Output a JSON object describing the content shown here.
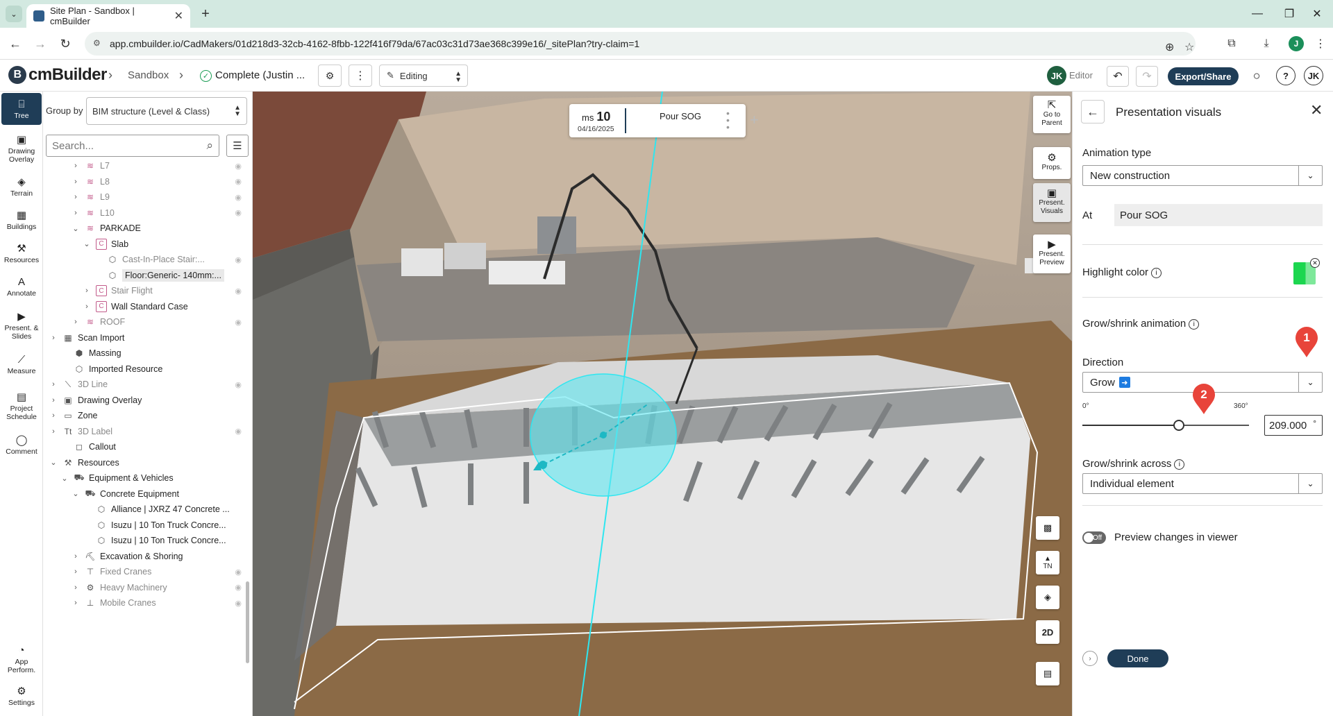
{
  "browser": {
    "tab_title": "Site Plan - Sandbox | cmBuilder",
    "tab_close": "✕",
    "new_tab": "+",
    "url": "app.cmbuilder.io/CadMakers/01d218d3-32cb-4162-8fbb-122f416f79da/67ac03c31d73ae368c399e16/_sitePlan?try-claim=1",
    "profile_initial": "J"
  },
  "header": {
    "logo_text": "cmBuilder",
    "crumb_project": "Sandbox",
    "crumb_status": "Complete (Justin ...",
    "mode_label": "Editing",
    "user_initials": "JK",
    "user_role": "Editor",
    "export_label": "Export/Share",
    "help_label": "?",
    "account_initials": "JK"
  },
  "rail": {
    "items": [
      {
        "label": "Tree"
      },
      {
        "label": "Drawing Overlay"
      },
      {
        "label": "Terrain"
      },
      {
        "label": "Buildings"
      },
      {
        "label": "Resources"
      },
      {
        "label": "Annotate"
      },
      {
        "label": "Present. & Slides"
      },
      {
        "label": "Measure"
      },
      {
        "label": "Project Schedule"
      },
      {
        "label": "Comment"
      },
      {
        "label": "App Perform."
      },
      {
        "label": "Settings"
      }
    ]
  },
  "tree": {
    "groupby_label": "Group by",
    "groupby_value": "BIM structure (Level & Class)",
    "search_placeholder": "Search...",
    "rows": [
      {
        "label": "L7",
        "indent": 2,
        "icon": "layer",
        "chev": "›",
        "dim": true
      },
      {
        "label": "L8",
        "indent": 2,
        "icon": "layer",
        "chev": "›",
        "dim": true
      },
      {
        "label": "L9",
        "indent": 2,
        "icon": "layer",
        "chev": "›",
        "dim": true
      },
      {
        "label": "L10",
        "indent": 2,
        "icon": "layer",
        "chev": "›",
        "dim": true
      },
      {
        "label": "PARKADE",
        "indent": 2,
        "icon": "layer",
        "chev": "⌄",
        "dim": false
      },
      {
        "label": "Slab",
        "indent": 3,
        "icon": "cls",
        "chev": "⌄",
        "dim": false
      },
      {
        "label": "Cast-In-Place Stair:...",
        "indent": 4,
        "icon": "cube",
        "chev": "",
        "dim": true
      },
      {
        "label": "Floor:Generic- 140mm:...",
        "indent": 4,
        "icon": "cube",
        "chev": "",
        "dim": false,
        "selected": true
      },
      {
        "label": "Stair Flight",
        "indent": 3,
        "icon": "cls",
        "chev": "›",
        "dim": true
      },
      {
        "label": "Wall Standard Case",
        "indent": 3,
        "icon": "cls",
        "chev": "›",
        "dim": false
      },
      {
        "label": "ROOF",
        "indent": 2,
        "icon": "layer",
        "chev": "›",
        "dim": true
      },
      {
        "label": "Scan Import",
        "indent": 0,
        "icon": "scan",
        "chev": "›",
        "dim": false
      },
      {
        "label": "Massing",
        "indent": 1,
        "icon": "massing",
        "chev": "",
        "dim": false
      },
      {
        "label": "Imported Resource",
        "indent": 1,
        "icon": "imported",
        "chev": "",
        "dim": false
      },
      {
        "label": "3D Line",
        "indent": 0,
        "icon": "line",
        "chev": "›",
        "dim": true
      },
      {
        "label": "Drawing Overlay",
        "indent": 0,
        "icon": "overlay",
        "chev": "›",
        "dim": false
      },
      {
        "label": "Zone",
        "indent": 0,
        "icon": "zone",
        "chev": "›",
        "dim": false
      },
      {
        "label": "3D Label",
        "indent": 0,
        "icon": "label3d",
        "chev": "›",
        "dim": true
      },
      {
        "label": "Callout",
        "indent": 1,
        "icon": "callout",
        "chev": "",
        "dim": false
      },
      {
        "label": "Resources",
        "indent": 0,
        "icon": "resources",
        "chev": "⌄",
        "dim": false
      },
      {
        "label": "Equipment & Vehicles",
        "indent": 1,
        "icon": "vehicle",
        "chev": "⌄",
        "dim": false
      },
      {
        "label": "Concrete Equipment",
        "indent": 2,
        "icon": "truck",
        "chev": "⌄",
        "dim": false
      },
      {
        "label": "Alliance | JXRZ 47 Concrete ...",
        "indent": 3,
        "icon": "cube",
        "chev": "",
        "dim": false
      },
      {
        "label": "Isuzu | 10 Ton Truck Concre...",
        "indent": 3,
        "icon": "cube",
        "chev": "",
        "dim": false
      },
      {
        "label": "Isuzu | 10 Ton Truck Concre...",
        "indent": 3,
        "icon": "cube",
        "chev": "",
        "dim": false
      },
      {
        "label": "Excavation & Shoring",
        "indent": 2,
        "icon": "excavator",
        "chev": "›",
        "dim": false
      },
      {
        "label": "Fixed Cranes",
        "indent": 2,
        "icon": "crane",
        "chev": "›",
        "dim": true
      },
      {
        "label": "Heavy Machinery",
        "indent": 2,
        "icon": "machinery",
        "chev": "›",
        "dim": true
      },
      {
        "label": "Mobile Cranes",
        "indent": 2,
        "icon": "mobilecrane",
        "chev": "›",
        "dim": true
      }
    ]
  },
  "viewer": {
    "milestone_prefix": "ms",
    "milestone_number": "10",
    "milestone_date": "04/16/2025",
    "task_name": "Pour SOG",
    "add_label": "+",
    "tools": [
      {
        "label": "Go to Parent"
      },
      {
        "label": "Props."
      },
      {
        "label": "Present. Visuals"
      },
      {
        "label": "Present. Preview"
      }
    ],
    "mini_tools": {
      "compass_label": "TN",
      "mode_label": "2D"
    }
  },
  "panel": {
    "title": "Presentation visuals",
    "animation_type_label": "Animation type",
    "animation_type_value": "New construction",
    "at_label": "At",
    "at_value": "Pour SOG",
    "highlight_label": "Highlight color",
    "grow_shrink_label": "Grow/shrink animation",
    "direction_label": "Direction",
    "direction_value": "Grow",
    "slider_min": "0°",
    "slider_max": "360°",
    "angle_value": "209.000",
    "angle_unit": "°",
    "angle_fraction": 0.58,
    "across_label": "Grow/shrink across",
    "across_value": "Individual element",
    "toggle_label": "Off",
    "preview_label": "Preview changes in viewer",
    "done_label": "Done"
  },
  "annotations": {
    "marker_1": "1",
    "marker_2": "2"
  },
  "colors": {
    "accent": "#1f3d57",
    "highlight": "#1cd64f",
    "marker": "#e8443a",
    "cyan": "#2ee6f0"
  }
}
